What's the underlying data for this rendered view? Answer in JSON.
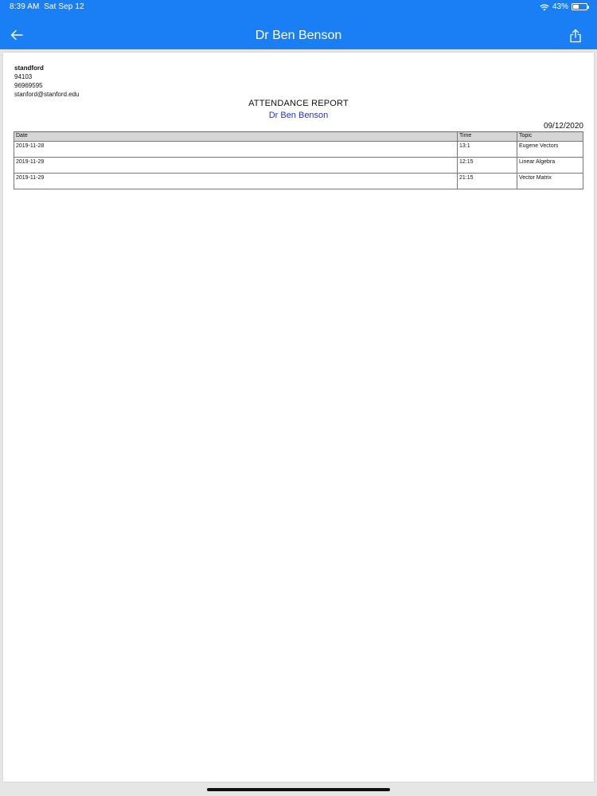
{
  "status_bar": {
    "time": "8:39 AM",
    "date": "Sat Sep 12",
    "battery": "43%",
    "battery_level": 0.43
  },
  "nav": {
    "title": "Dr Ben Benson",
    "back_icon": "arrow-left-icon",
    "share_icon": "share-icon"
  },
  "document": {
    "org": {
      "name": "standford",
      "zip": "94103",
      "phone": "96969595",
      "email": "stanford@stanford.edu"
    },
    "title": "ATTENDANCE REPORT",
    "subtitle": "Dr Ben Benson",
    "date": "09/12/2020",
    "table": {
      "headers": [
        "Date",
        "Time",
        "Topic"
      ],
      "rows": [
        [
          "2019-11-28",
          "13:1",
          "Eugene Vectors"
        ],
        [
          "2019-11-29",
          "12:15",
          "Linear Algebra"
        ],
        [
          "2019-11-29",
          "21:15",
          "Vector Matrix"
        ]
      ]
    }
  },
  "colors": {
    "brand": "#1a7ff5",
    "subtitle": "#2437c9"
  }
}
